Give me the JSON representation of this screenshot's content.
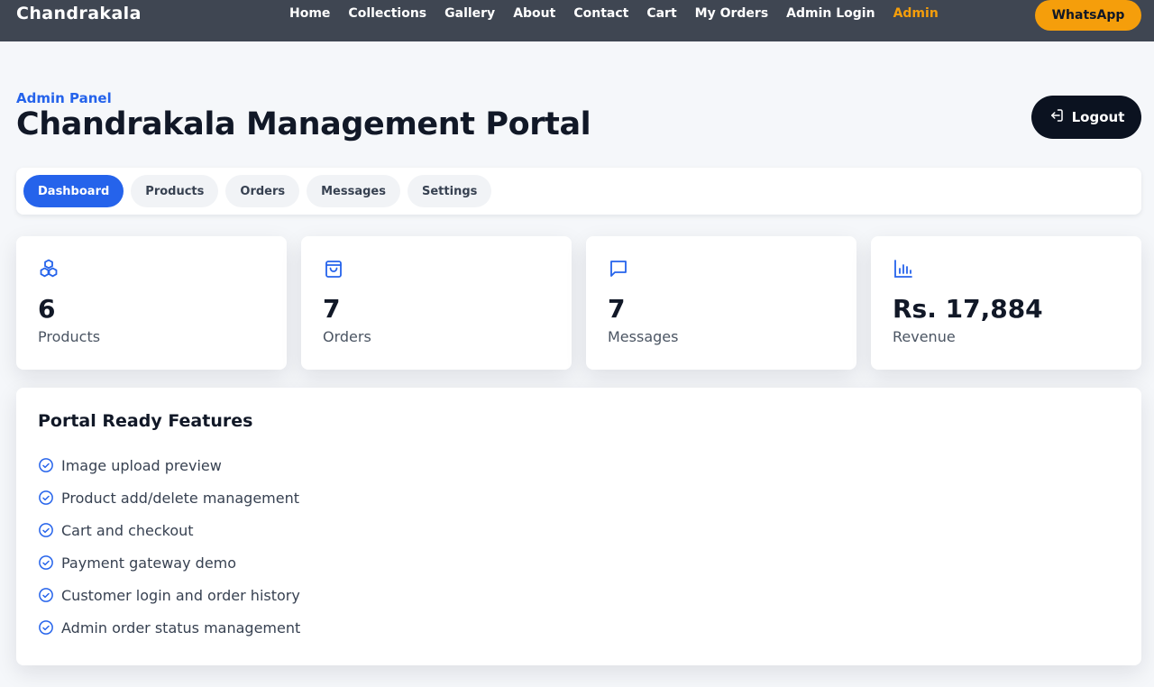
{
  "brand": "Chandrakala",
  "nav": [
    {
      "label": "Home",
      "active": false
    },
    {
      "label": "Collections",
      "active": false
    },
    {
      "label": "Gallery",
      "active": false
    },
    {
      "label": "About",
      "active": false
    },
    {
      "label": "Contact",
      "active": false
    },
    {
      "label": "Cart",
      "active": false
    },
    {
      "label": "My Orders",
      "active": false
    },
    {
      "label": "Admin Login",
      "active": false
    },
    {
      "label": "Admin",
      "active": true
    }
  ],
  "whatsapp_label": "WhatsApp",
  "header": {
    "eyebrow": "Admin Panel",
    "title": "Chandrakala Management Portal",
    "logout_label": "Logout",
    "logout_icon": "logout-icon"
  },
  "tabs": [
    {
      "label": "Dashboard",
      "active": true
    },
    {
      "label": "Products",
      "active": false
    },
    {
      "label": "Orders",
      "active": false
    },
    {
      "label": "Messages",
      "active": false
    },
    {
      "label": "Settings",
      "active": false
    }
  ],
  "stats": [
    {
      "icon": "cubes-icon",
      "value": "6",
      "label": "Products"
    },
    {
      "icon": "shopping-bag-icon",
      "value": "7",
      "label": "Orders"
    },
    {
      "icon": "message-icon",
      "value": "7",
      "label": "Messages"
    },
    {
      "icon": "bar-chart-icon",
      "value": "Rs. 17,884",
      "label": "Revenue"
    }
  ],
  "features": {
    "title": "Portal Ready Features",
    "items": [
      "Image upload preview",
      "Product add/delete management",
      "Cart and checkout",
      "Payment gateway demo",
      "Customer login and order history",
      "Admin order status management"
    ]
  },
  "colors": {
    "topbar": "#3f4652",
    "accent_blue": "#2563eb",
    "accent_orange": "#f59e0b",
    "dark": "#0b1220"
  }
}
